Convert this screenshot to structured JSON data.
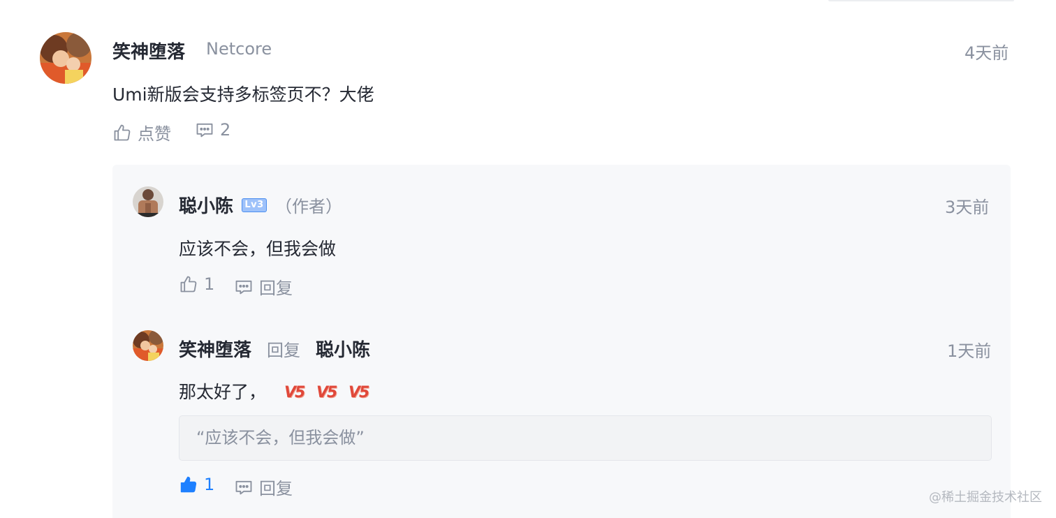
{
  "comment": {
    "author": "笑神堕落",
    "company": "Netcore",
    "time": "4天前",
    "content": "Umi新版会支持多标签页不？大佬",
    "like_label": "点赞",
    "comment_count": "2",
    "avatar_icon": "user-avatar"
  },
  "replies": [
    {
      "author": "聪小陈",
      "level_badge": "Lv3",
      "author_tag": "（作者）",
      "time": "3天前",
      "content": "应该不会，但我会做",
      "like_count": "1",
      "reply_label": "回复",
      "avatar_icon": "user-avatar"
    },
    {
      "author": "笑神堕落",
      "reply_word": "回复",
      "reply_to": "聪小陈",
      "time": "1天前",
      "content": "那太好了，",
      "emojis": [
        "V5",
        "V5",
        "V5"
      ],
      "quote": "“应该不会，但我会做”",
      "like_count": "1",
      "liked": true,
      "reply_label": "回复",
      "avatar_icon": "user-avatar"
    }
  ],
  "watermark": "@稀土掘金技术社区",
  "colors": {
    "accent": "#1e80ff",
    "muted": "#8a919f",
    "text": "#252933",
    "reply_bg": "#f7f8fa"
  }
}
